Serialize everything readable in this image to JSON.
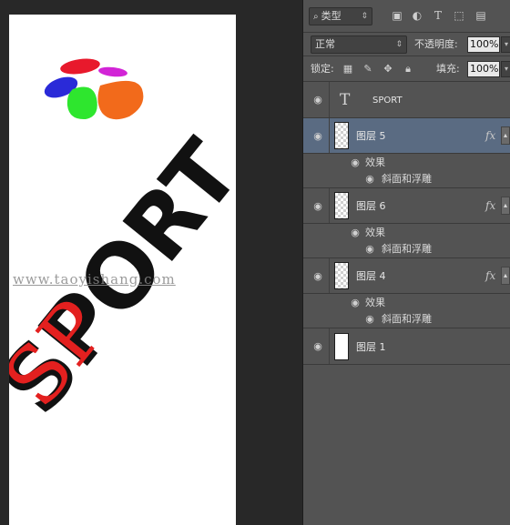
{
  "canvas": {
    "watermark": "www.taoyishang.com",
    "logo_text": "SPORT",
    "colors": {
      "background": "#282828",
      "document": "#ffffff",
      "text_black": "#111111",
      "text_red": "#e3201f",
      "petal_red": "#e8192c",
      "petal_magenta": "#d224d6",
      "petal_blue": "#2a2ad8",
      "petal_green": "#2ee62e",
      "petal_orange": "#f26a1b"
    }
  },
  "layers_panel": {
    "filter": {
      "kind": "类型",
      "icons": [
        "image-filter-icon",
        "adjustment-filter-icon",
        "type-filter-icon",
        "shape-filter-icon",
        "smart-object-filter-icon"
      ]
    },
    "blend": {
      "mode": "正常",
      "opacity_label": "不透明度:",
      "opacity_value": "100%"
    },
    "lock": {
      "label": "锁定:",
      "icons": [
        "lock-transparent-icon",
        "lock-paint-icon",
        "lock-move-icon",
        "lock-all-icon"
      ],
      "fill_label": "填充:",
      "fill_value": "100%"
    },
    "layers": [
      {
        "name": "SPORT",
        "type": "text",
        "selected": false,
        "effects": null
      },
      {
        "name": "图层 5",
        "type": "pixel",
        "selected": true,
        "effects": {
          "label": "效果",
          "items": [
            "斜面和浮雕"
          ]
        }
      },
      {
        "name": "图层 6",
        "type": "pixel",
        "selected": false,
        "effects": {
          "label": "效果",
          "items": [
            "斜面和浮雕"
          ]
        }
      },
      {
        "name": "图层 4",
        "type": "pixel",
        "selected": false,
        "effects": {
          "label": "效果",
          "items": [
            "斜面和浮雕"
          ]
        }
      },
      {
        "name": "图层 1",
        "type": "background",
        "selected": false,
        "effects": null
      }
    ],
    "fx_label": "fx",
    "colors": {
      "panel": "#535353",
      "selected": "#5a6b82"
    }
  }
}
